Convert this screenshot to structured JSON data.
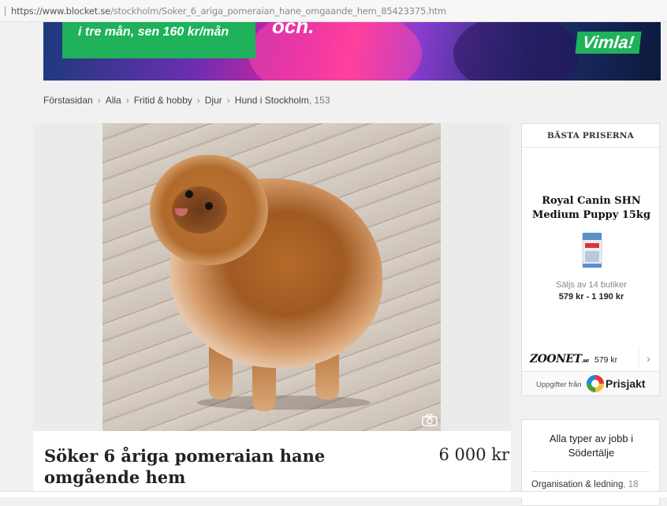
{
  "browser": {
    "url_domain": "https://www.blocket.se",
    "url_path": "/stockholm/Soker_6_ariga_pomeraian_hane_omgaande_hem_85423375.htm"
  },
  "banner": {
    "headline_partial": "och.",
    "promo_line": "i tre mån, sen 160 kr/mån",
    "brand": "Vimla!"
  },
  "breadcrumb": {
    "items": [
      "Förstasidan",
      "Alla",
      "Fritid & hobby",
      "Djur",
      "Hund i Stockholm"
    ],
    "count": ", 153"
  },
  "listing": {
    "title": "Söker 6 åriga pomeraian hane omgående hem",
    "price": "6 000 kr"
  },
  "price_widget": {
    "heading": "BÄSTA PRISERNA",
    "product_name": "Royal Canin SHN Medium Puppy 15kg",
    "sold_by": "Säljs av 14 butiker",
    "price_range": "579 kr - 1 190 kr",
    "store_name": "ZOONET",
    "store_suffix": ".se",
    "store_price": "579 kr",
    "data_from": "Uppgifter från",
    "provider": "Prisjakt"
  },
  "jobs_widget": {
    "title": "Alla typer av jobb i Södertälje",
    "category": "Organisation & ledning",
    "category_count": ", 18"
  }
}
